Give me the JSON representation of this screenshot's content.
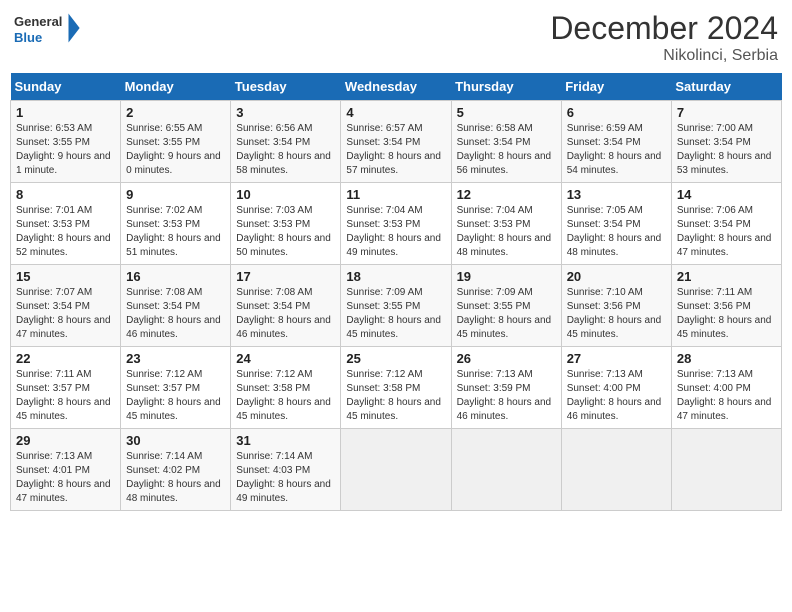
{
  "logo": {
    "line1": "General",
    "line2": "Blue"
  },
  "title": "December 2024",
  "subtitle": "Nikolinci, Serbia",
  "days_header": [
    "Sunday",
    "Monday",
    "Tuesday",
    "Wednesday",
    "Thursday",
    "Friday",
    "Saturday"
  ],
  "weeks": [
    [
      {
        "num": "1",
        "rise": "6:53 AM",
        "set": "3:55 PM",
        "daylight": "9 hours and 1 minute."
      },
      {
        "num": "2",
        "rise": "6:55 AM",
        "set": "3:55 PM",
        "daylight": "9 hours and 0 minutes."
      },
      {
        "num": "3",
        "rise": "6:56 AM",
        "set": "3:54 PM",
        "daylight": "8 hours and 58 minutes."
      },
      {
        "num": "4",
        "rise": "6:57 AM",
        "set": "3:54 PM",
        "daylight": "8 hours and 57 minutes."
      },
      {
        "num": "5",
        "rise": "6:58 AM",
        "set": "3:54 PM",
        "daylight": "8 hours and 56 minutes."
      },
      {
        "num": "6",
        "rise": "6:59 AM",
        "set": "3:54 PM",
        "daylight": "8 hours and 54 minutes."
      },
      {
        "num": "7",
        "rise": "7:00 AM",
        "set": "3:54 PM",
        "daylight": "8 hours and 53 minutes."
      }
    ],
    [
      {
        "num": "8",
        "rise": "7:01 AM",
        "set": "3:53 PM",
        "daylight": "8 hours and 52 minutes."
      },
      {
        "num": "9",
        "rise": "7:02 AM",
        "set": "3:53 PM",
        "daylight": "8 hours and 51 minutes."
      },
      {
        "num": "10",
        "rise": "7:03 AM",
        "set": "3:53 PM",
        "daylight": "8 hours and 50 minutes."
      },
      {
        "num": "11",
        "rise": "7:04 AM",
        "set": "3:53 PM",
        "daylight": "8 hours and 49 minutes."
      },
      {
        "num": "12",
        "rise": "7:04 AM",
        "set": "3:53 PM",
        "daylight": "8 hours and 48 minutes."
      },
      {
        "num": "13",
        "rise": "7:05 AM",
        "set": "3:54 PM",
        "daylight": "8 hours and 48 minutes."
      },
      {
        "num": "14",
        "rise": "7:06 AM",
        "set": "3:54 PM",
        "daylight": "8 hours and 47 minutes."
      }
    ],
    [
      {
        "num": "15",
        "rise": "7:07 AM",
        "set": "3:54 PM",
        "daylight": "8 hours and 47 minutes."
      },
      {
        "num": "16",
        "rise": "7:08 AM",
        "set": "3:54 PM",
        "daylight": "8 hours and 46 minutes."
      },
      {
        "num": "17",
        "rise": "7:08 AM",
        "set": "3:54 PM",
        "daylight": "8 hours and 46 minutes."
      },
      {
        "num": "18",
        "rise": "7:09 AM",
        "set": "3:55 PM",
        "daylight": "8 hours and 45 minutes."
      },
      {
        "num": "19",
        "rise": "7:09 AM",
        "set": "3:55 PM",
        "daylight": "8 hours and 45 minutes."
      },
      {
        "num": "20",
        "rise": "7:10 AM",
        "set": "3:56 PM",
        "daylight": "8 hours and 45 minutes."
      },
      {
        "num": "21",
        "rise": "7:11 AM",
        "set": "3:56 PM",
        "daylight": "8 hours and 45 minutes."
      }
    ],
    [
      {
        "num": "22",
        "rise": "7:11 AM",
        "set": "3:57 PM",
        "daylight": "8 hours and 45 minutes."
      },
      {
        "num": "23",
        "rise": "7:12 AM",
        "set": "3:57 PM",
        "daylight": "8 hours and 45 minutes."
      },
      {
        "num": "24",
        "rise": "7:12 AM",
        "set": "3:58 PM",
        "daylight": "8 hours and 45 minutes."
      },
      {
        "num": "25",
        "rise": "7:12 AM",
        "set": "3:58 PM",
        "daylight": "8 hours and 45 minutes."
      },
      {
        "num": "26",
        "rise": "7:13 AM",
        "set": "3:59 PM",
        "daylight": "8 hours and 46 minutes."
      },
      {
        "num": "27",
        "rise": "7:13 AM",
        "set": "4:00 PM",
        "daylight": "8 hours and 46 minutes."
      },
      {
        "num": "28",
        "rise": "7:13 AM",
        "set": "4:00 PM",
        "daylight": "8 hours and 47 minutes."
      }
    ],
    [
      {
        "num": "29",
        "rise": "7:13 AM",
        "set": "4:01 PM",
        "daylight": "8 hours and 47 minutes."
      },
      {
        "num": "30",
        "rise": "7:14 AM",
        "set": "4:02 PM",
        "daylight": "8 hours and 48 minutes."
      },
      {
        "num": "31",
        "rise": "7:14 AM",
        "set": "4:03 PM",
        "daylight": "8 hours and 49 minutes."
      },
      null,
      null,
      null,
      null
    ]
  ]
}
